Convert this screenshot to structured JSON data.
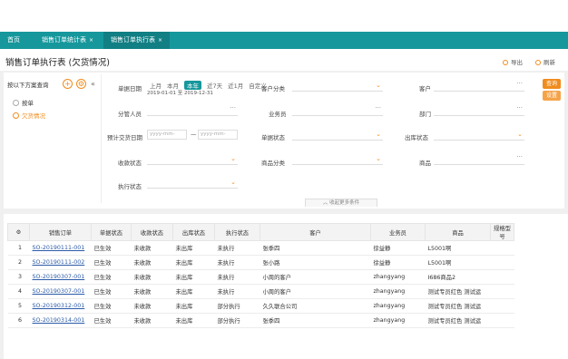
{
  "tabs": [
    {
      "label": "首页"
    },
    {
      "label": "销售订单统计表",
      "close": "×"
    },
    {
      "label": "销售订单执行表",
      "close": "×"
    }
  ],
  "header": {
    "title": "销售订单执行表 (欠货情况)",
    "export_label": "导出",
    "refresh_label": "刷新"
  },
  "left_panel": {
    "title": "按以下方案查询",
    "items": [
      {
        "label": "按单"
      },
      {
        "label": "欠货情况"
      }
    ]
  },
  "filters": {
    "order_date_label": "单据日期",
    "date_presets": [
      "上月",
      "本月",
      "本年",
      "近7天",
      "近1月",
      "自定义"
    ],
    "date_range": "2019-01-01 至 2019-12-31",
    "customer_category_label": "客户分类",
    "customer_label": "客户",
    "assignee_label": "分管人员",
    "salesperson_label": "业务员",
    "department_label": "部门",
    "delivery_date_label": "预计交货日期",
    "date_placeholder": "yyyy-mm-",
    "doc_status_label": "单据状态",
    "out_status_label": "出库状态",
    "receipt_status_label": "收款状态",
    "product_category_label": "商品分类",
    "product_label": "商品",
    "exec_status_label": "执行状态",
    "query_label": "查询",
    "reset_label": "设置",
    "more_label": "收起更多条件"
  },
  "table": {
    "columns": [
      "",
      "销售订单",
      "单据状态",
      "收款状态",
      "出库状态",
      "执行状态",
      "客户",
      "业务员",
      "商品",
      "规格型号"
    ],
    "rows": [
      [
        "1",
        "SO-20190111-001",
        "已生效",
        "未收款",
        "未出库",
        "未执行",
        "张季四",
        "徐益静",
        "L5001啊",
        ""
      ],
      [
        "2",
        "SO-20190111-002",
        "已生效",
        "未收款",
        "未出库",
        "未执行",
        "张小路",
        "徐益静",
        "L5001啊",
        ""
      ],
      [
        "3",
        "SO-20190307-001",
        "已生效",
        "未收款",
        "未出库",
        "未执行",
        "小周的客户",
        "zhangyang",
        "I686商品2",
        ""
      ],
      [
        "4",
        "SO-20190307-001",
        "已生效",
        "未收款",
        "未出库",
        "未执行",
        "小周的客户",
        "zhangyang",
        "测试专员红色 测试运",
        ""
      ],
      [
        "5",
        "SO-20190312-001",
        "已生效",
        "未收款",
        "未出库",
        "部分执行",
        "久久联合公司",
        "zhangyang",
        "测试专员红色 测试运",
        ""
      ],
      [
        "6",
        "SO-20190314-001",
        "已生效",
        "未收款",
        "未出库",
        "部分执行",
        "张季四",
        "zhangyang",
        "测试专员红色 测试运",
        ""
      ]
    ]
  }
}
